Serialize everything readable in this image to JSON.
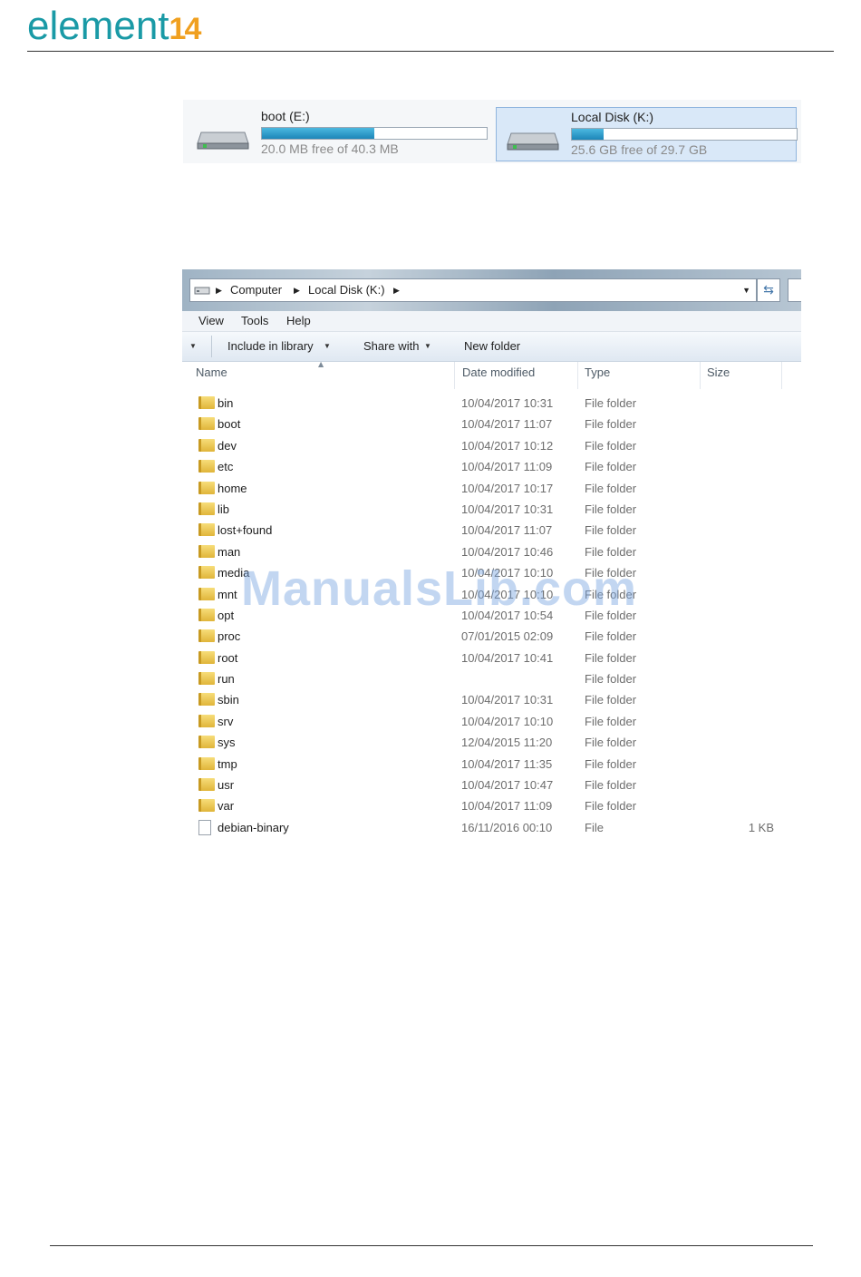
{
  "header": {
    "logo_text": "element",
    "logo_number": "14"
  },
  "drives": [
    {
      "name": "boot (E:)",
      "free_text": "20.0 MB free of 40.3 MB",
      "used_fraction": 0.5,
      "selected": false
    },
    {
      "name": "Local Disk (K:)",
      "free_text": "25.6 GB free of 29.7 GB",
      "used_fraction": 0.14,
      "selected": true
    }
  ],
  "explorer": {
    "address": {
      "segments": [
        "Computer",
        "Local Disk (K:)"
      ]
    },
    "menu": [
      "View",
      "Tools",
      "Help"
    ],
    "toolbar": {
      "include_library": "Include in library",
      "share_with": "Share with",
      "new_folder": "New folder"
    },
    "columns": {
      "name": "Name",
      "date": "Date modified",
      "type": "Type",
      "size": "Size"
    },
    "rows": [
      {
        "name": "bin",
        "date": "10/04/2017 10:31",
        "type": "File folder",
        "size": "",
        "kind": "folder"
      },
      {
        "name": "boot",
        "date": "10/04/2017 11:07",
        "type": "File folder",
        "size": "",
        "kind": "folder"
      },
      {
        "name": "dev",
        "date": "10/04/2017 10:12",
        "type": "File folder",
        "size": "",
        "kind": "folder"
      },
      {
        "name": "etc",
        "date": "10/04/2017 11:09",
        "type": "File folder",
        "size": "",
        "kind": "folder"
      },
      {
        "name": "home",
        "date": "10/04/2017 10:17",
        "type": "File folder",
        "size": "",
        "kind": "folder"
      },
      {
        "name": "lib",
        "date": "10/04/2017 10:31",
        "type": "File folder",
        "size": "",
        "kind": "folder"
      },
      {
        "name": "lost+found",
        "date": "10/04/2017 11:07",
        "type": "File folder",
        "size": "",
        "kind": "folder"
      },
      {
        "name": "man",
        "date": "10/04/2017 10:46",
        "type": "File folder",
        "size": "",
        "kind": "folder"
      },
      {
        "name": "media",
        "date": "10/04/2017 10:10",
        "type": "File folder",
        "size": "",
        "kind": "folder"
      },
      {
        "name": "mnt",
        "date": "10/04/2017 10:10",
        "type": "File folder",
        "size": "",
        "kind": "folder"
      },
      {
        "name": "opt",
        "date": "10/04/2017 10:54",
        "type": "File folder",
        "size": "",
        "kind": "folder"
      },
      {
        "name": "proc",
        "date": "07/01/2015 02:09",
        "type": "File folder",
        "size": "",
        "kind": "folder"
      },
      {
        "name": "root",
        "date": "10/04/2017 10:41",
        "type": "File folder",
        "size": "",
        "kind": "folder"
      },
      {
        "name": "run",
        "date": "",
        "type": "File folder",
        "size": "",
        "kind": "folder"
      },
      {
        "name": "sbin",
        "date": "10/04/2017 10:31",
        "type": "File folder",
        "size": "",
        "kind": "folder"
      },
      {
        "name": "srv",
        "date": "10/04/2017 10:10",
        "type": "File folder",
        "size": "",
        "kind": "folder"
      },
      {
        "name": "sys",
        "date": "12/04/2015 11:20",
        "type": "File folder",
        "size": "",
        "kind": "folder"
      },
      {
        "name": "tmp",
        "date": "10/04/2017 11:35",
        "type": "File folder",
        "size": "",
        "kind": "folder"
      },
      {
        "name": "usr",
        "date": "10/04/2017 10:47",
        "type": "File folder",
        "size": "",
        "kind": "folder"
      },
      {
        "name": "var",
        "date": "10/04/2017 11:09",
        "type": "File folder",
        "size": "",
        "kind": "folder"
      },
      {
        "name": "debian-binary",
        "date": "16/11/2016 00:10",
        "type": "File",
        "size": "1 KB",
        "kind": "file"
      }
    ]
  },
  "watermark": "ManualsLib.com",
  "colors": {
    "logo": "#1a9aa6",
    "logo_number": "#f0a020",
    "bar_fill": "#1d86b8",
    "selected_bg": "#d9e8f8"
  }
}
